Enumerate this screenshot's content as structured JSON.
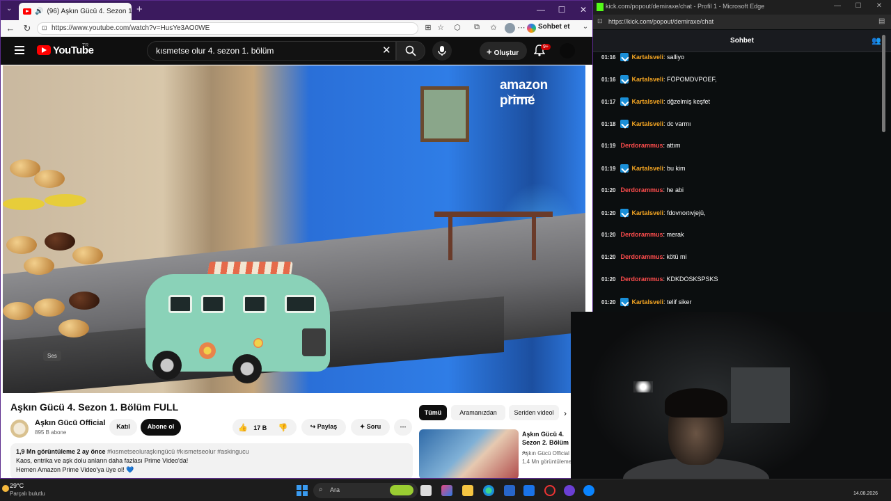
{
  "left_window": {
    "tab_title": "(96) Aşkın Gücü 4. Sezon 1. Bö",
    "url": "https://www.youtube.com/watch?v=HusYe3AO0WE",
    "copilot_label": "Sohbet et",
    "youtube": {
      "logo": "YouTube",
      "region": "TR",
      "search_query": "kısmetse olur 4. sezon 1. bölüm",
      "create_label": "Oluştur",
      "notif_count": "9+",
      "video_overlay": "amazon prime",
      "tooltip": "Ses",
      "video_title": "Aşkın Gücü 4. Sezon 1. Bölüm FULL",
      "channel_name": "Aşkın Gücü Official",
      "subscribers": "895 B abone",
      "join_label": "Katıl",
      "subscribe_label": "Abone ol",
      "like_count": "17 B",
      "share_label": "Paylaş",
      "ask_label": "Soru",
      "desc_stats": "1,9 Mn görüntüleme  2 ay önce",
      "desc_tags": "#kısmetseoluraşkıngücü #kısmetseolur #askingucu",
      "desc_line1": "Kaos, entrika ve aşk dolu anların daha fazlası Prime Video'da!",
      "desc_line2": "Hemen Amazon Prime Video'ya üye ol! 💙",
      "chips": [
        "Tümü",
        "Aramanızdan",
        "Seriden videol"
      ],
      "rec_title": "Aşkın Gücü 4. Sezon 2. Bölüm ...",
      "rec_channel": "Aşkın Gücü Official",
      "rec_views": "1,4 Mn görüntüleme"
    }
  },
  "right_window": {
    "title": "kick.com/popout/demiraxe/chat - Profil 1 - Microsoft Edge",
    "url": "https://kick.com/popout/demiraxe/chat",
    "header": "Sohbet",
    "messages": [
      {
        "time": "01:16",
        "user": "Kartalsveli",
        "text": ": salliyo",
        "badge": true,
        "color": "#f5a623"
      },
      {
        "time": "01:16",
        "user": "Kartalsveli",
        "text": ": FÖPOMDVPOEF,",
        "badge": true,
        "color": "#f5a623"
      },
      {
        "time": "01:17",
        "user": "Kartalsveli",
        "text": ": dğzelmiş keşfet",
        "badge": true,
        "color": "#f5a623"
      },
      {
        "time": "01:18",
        "user": "Kartalsveli",
        "text": ": dc varmı",
        "badge": true,
        "color": "#f5a623"
      },
      {
        "time": "01:19",
        "user": "Derdorammus",
        "text": ": attım",
        "badge": false,
        "color": "#ff4d4d"
      },
      {
        "time": "01:19",
        "user": "Kartalsveli",
        "text": ": bu kim",
        "badge": true,
        "color": "#f5a623"
      },
      {
        "time": "01:20",
        "user": "Derdorammus",
        "text": ": he abi",
        "badge": false,
        "color": "#ff4d4d"
      },
      {
        "time": "01:20",
        "user": "Kartalsveli",
        "text": ": fdovnoıtıvjejü,",
        "badge": true,
        "color": "#f5a623"
      },
      {
        "time": "01:20",
        "user": "Derdorammus",
        "text": ": merak",
        "badge": false,
        "color": "#ff4d4d"
      },
      {
        "time": "01:20",
        "user": "Derdorammus",
        "text": ": kötü mi",
        "badge": false,
        "color": "#ff4d4d"
      },
      {
        "time": "01:20",
        "user": "Derdorammus",
        "text": ": KDKDOSKSPSKS",
        "badge": false,
        "color": "#ff4d4d"
      },
      {
        "time": "01:20",
        "user": "Kartalsveli",
        "text": ": telif siker",
        "badge": true,
        "color": "#f5a623"
      }
    ]
  },
  "taskbar": {
    "temperature": "29°C",
    "weather": "Parçalı bulutlu",
    "search_placeholder": "Ara",
    "date": "14.08.2026"
  },
  "colors": {
    "edge_frame": "#3b1a5e",
    "youtube_red": "#ff0000",
    "kick_green": "#53fc18"
  }
}
